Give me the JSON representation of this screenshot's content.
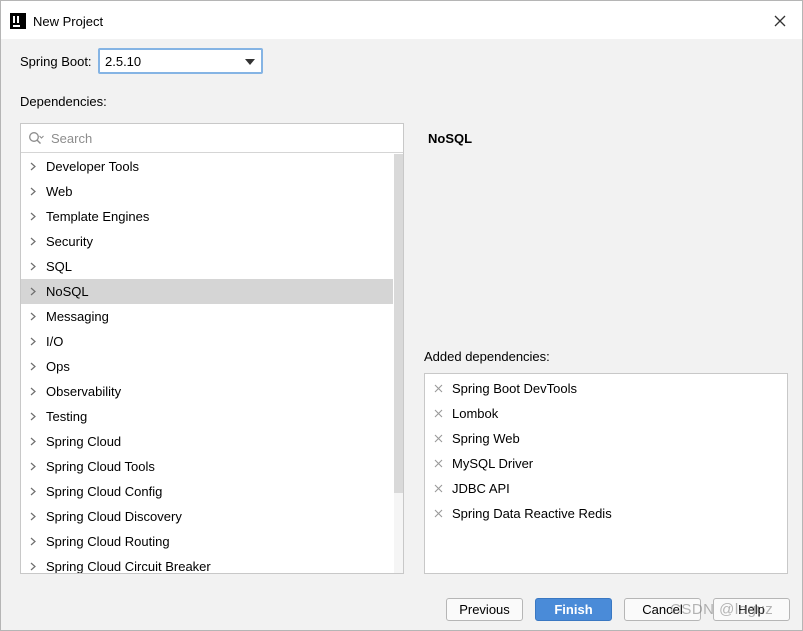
{
  "window": {
    "title": "New Project"
  },
  "spring_boot": {
    "label": "Spring Boot:",
    "value": "2.5.10"
  },
  "dependencies": {
    "label": "Dependencies:",
    "search_placeholder": "Search",
    "categories": [
      "Developer Tools",
      "Web",
      "Template Engines",
      "Security",
      "SQL",
      "NoSQL",
      "Messaging",
      "I/O",
      "Ops",
      "Observability",
      "Testing",
      "Spring Cloud",
      "Spring Cloud Tools",
      "Spring Cloud Config",
      "Spring Cloud Discovery",
      "Spring Cloud Routing",
      "Spring Cloud Circuit Breaker"
    ],
    "selected": "NoSQL"
  },
  "detail": {
    "title": "NoSQL"
  },
  "added": {
    "label": "Added dependencies:",
    "items": [
      "Spring Boot DevTools",
      "Lombok",
      "Spring Web",
      "MySQL Driver",
      "JDBC API",
      "Spring Data Reactive Redis"
    ]
  },
  "buttons": {
    "previous": "Previous",
    "finish": "Finish",
    "cancel": "Cancel",
    "help": "Help"
  },
  "watermark": "CSDN @laguz",
  "colors": {
    "accent": "#4a8bd8",
    "selection": "#d5d5d5",
    "focus_border": "#85b4e4"
  }
}
